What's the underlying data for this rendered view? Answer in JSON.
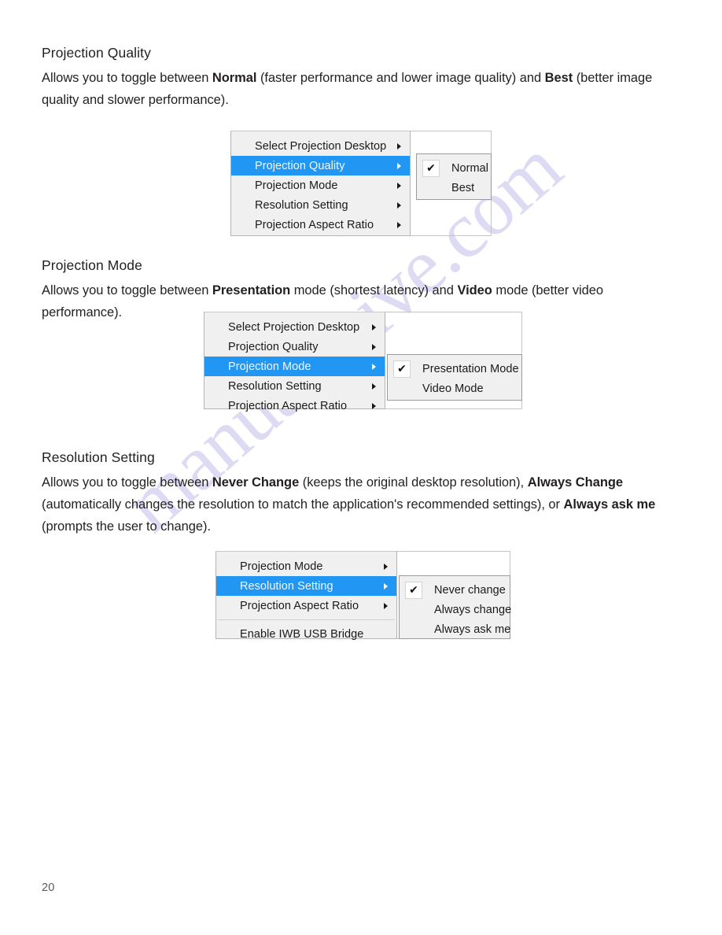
{
  "document": {
    "page_number": "20",
    "watermark": "manualshive.com"
  },
  "sections": [
    {
      "title": "Projection Quality",
      "body_html": "Allows you to toggle between <b>Normal</b> (faster performance and lower image quality) and <b>Best</b> (better image quality and slower performance)."
    },
    {
      "title": "Projection Mode",
      "body_html": "Allows you to toggle between <b>Presentation</b> mode (shortest latency) and <b>Video</b> mode (better video performance)."
    },
    {
      "title": "Resolution Setting",
      "body_html": "Allows you to toggle between <b>Never Change</b> (keeps the original desktop resolution), <b>Always Change</b> (automatically changes the resolution to match the application's recommended settings), or <b>Always ask me</b> (prompts the user to change)."
    }
  ],
  "menus": {
    "quality": {
      "items": [
        {
          "label": "Select Projection Desktop",
          "selected": false,
          "submenu_arrow": true,
          "separator_before": false
        },
        {
          "label": "Projection Quality",
          "selected": true,
          "submenu_arrow": true,
          "separator_before": false
        },
        {
          "label": "Projection Mode",
          "selected": false,
          "submenu_arrow": true,
          "separator_before": false
        },
        {
          "label": "Resolution Setting",
          "selected": false,
          "submenu_arrow": true,
          "separator_before": false
        },
        {
          "label": "Projection Aspect Ratio",
          "selected": false,
          "submenu_arrow": true,
          "separator_before": false
        }
      ],
      "submenu": [
        {
          "label": "Normal",
          "checked": true
        },
        {
          "label": "Best",
          "checked": false
        }
      ]
    },
    "mode": {
      "items": [
        {
          "label": "Select Projection Desktop",
          "selected": false,
          "submenu_arrow": true,
          "separator_before": false
        },
        {
          "label": "Projection Quality",
          "selected": false,
          "submenu_arrow": true,
          "separator_before": false
        },
        {
          "label": "Projection Mode",
          "selected": true,
          "submenu_arrow": true,
          "separator_before": false
        },
        {
          "label": "Resolution Setting",
          "selected": false,
          "submenu_arrow": true,
          "separator_before": false
        },
        {
          "label": "Projection Aspect Ratio",
          "selected": false,
          "submenu_arrow": true,
          "separator_before": false
        }
      ],
      "submenu": [
        {
          "label": "Presentation Mode",
          "checked": true
        },
        {
          "label": "Video Mode",
          "checked": false
        }
      ]
    },
    "resolution": {
      "items": [
        {
          "label": "Projection Mode",
          "selected": false,
          "submenu_arrow": true,
          "separator_before": false
        },
        {
          "label": "Resolution Setting",
          "selected": true,
          "submenu_arrow": true,
          "separator_before": false
        },
        {
          "label": "Projection Aspect Ratio",
          "selected": false,
          "submenu_arrow": true,
          "separator_before": false
        },
        {
          "label": "Enable IWB USB Bridge",
          "selected": false,
          "submenu_arrow": false,
          "separator_before": true
        }
      ],
      "submenu": [
        {
          "label": "Never change",
          "checked": true
        },
        {
          "label": "Always change",
          "checked": false
        },
        {
          "label": "Always ask me",
          "checked": false
        }
      ]
    }
  },
  "colors": {
    "highlight": "#2196f3",
    "menu_background": "#f0f0f0",
    "menu_border": "#b4b4b4",
    "text": "#1a1a1a",
    "watermark": "#c9c6ec"
  },
  "icons": {
    "submenu_arrow": "submenu-arrow-icon",
    "check": "✔"
  }
}
